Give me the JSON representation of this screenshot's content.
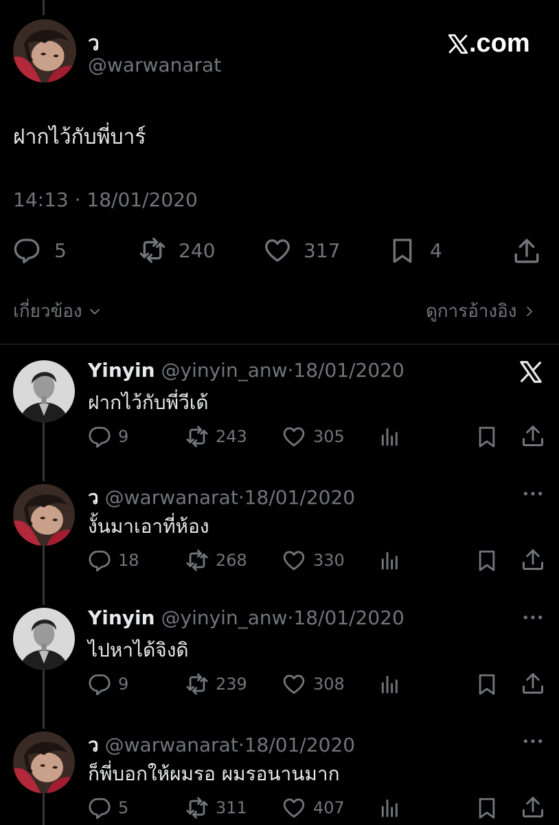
{
  "header": {
    "display_name": "ว",
    "handle": "@warwanarat",
    "brand": "X.com"
  },
  "main_tweet": {
    "text": "ฝากไว้กับพี่บาร์",
    "timestamp": "14:13 · 18/01/2020",
    "replies": "5",
    "reposts": "240",
    "likes": "317",
    "bookmarks": "4"
  },
  "links": {
    "related": "เกี่ยวข้อง",
    "view_quotes": "ดูการอ้างอิง"
  },
  "replies": [
    {
      "name": "Yinyin",
      "handle": "@yinyin_anw",
      "date": "18/01/2020",
      "text": "ฝากไว้กับพี่วีเด้",
      "replies": "9",
      "reposts": "243",
      "likes": "305"
    },
    {
      "name": "ว",
      "handle": "@warwanarat",
      "date": "18/01/2020",
      "text": "งั้นมาเอาที่ห้อง",
      "replies": "18",
      "reposts": "268",
      "likes": "330"
    },
    {
      "name": "Yinyin",
      "handle": "@yinyin_anw",
      "date": "18/01/2020",
      "text": "ไปหาได้จิงดิ",
      "replies": "9",
      "reposts": "239",
      "likes": "308"
    },
    {
      "name": "ว",
      "handle": "@warwanarat",
      "date": "18/01/2020",
      "text": "ก็พี่บอกให้ผมรอ ผมรอนานมาก",
      "replies": "5",
      "reposts": "311",
      "likes": "407"
    }
  ],
  "sep": "·",
  "icons": {
    "reply": "speech-bubble-icon",
    "repost": "repost-arrows-icon",
    "like": "heart-icon",
    "bookmark": "bookmark-icon",
    "share": "share-upload-icon",
    "views": "bar-chart-icon",
    "more": "more-dots-icon",
    "brand": "x-logo-icon"
  },
  "colors": {
    "background": "#000000",
    "text": "#e7e9ea",
    "muted": "#71767b",
    "divider": "#2f3336"
  }
}
